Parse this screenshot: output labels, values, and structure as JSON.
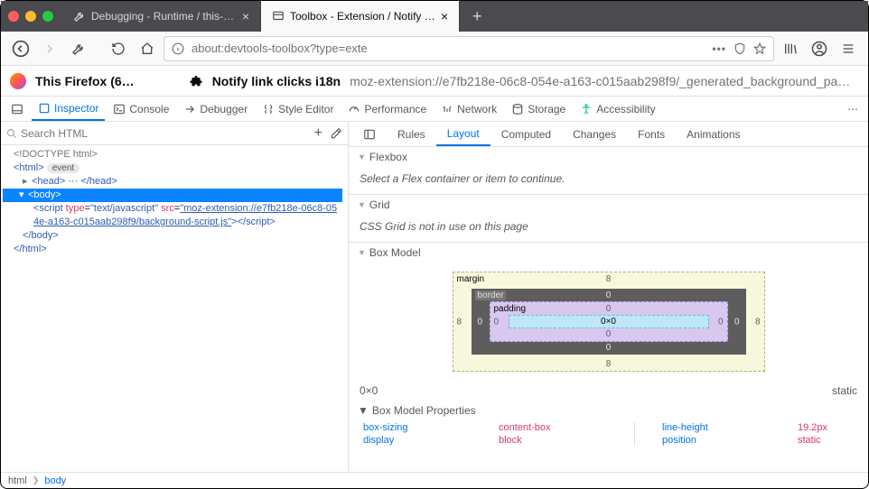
{
  "tabs": {
    "bg": {
      "title": "Debugging - Runtime / this-fire"
    },
    "active": {
      "title": "Toolbox - Extension / Notify link"
    }
  },
  "urlbar": {
    "url": "about:devtools-toolbox?type=exte"
  },
  "target": {
    "firefoxLabel": "This Firefox (6…",
    "extName": "Notify link clicks i18n",
    "extUrl": "moz-extension://e7fb218e-06c8-054e-a163-c015aab298f9/_generated_background_pa…"
  },
  "devtabs": {
    "inspector": "Inspector",
    "console": "Console",
    "debugger": "Debugger",
    "styleEditor": "Style Editor",
    "performance": "Performance",
    "network": "Network",
    "storage": "Storage",
    "accessibility": "Accessibility"
  },
  "search": {
    "placeholder": "Search HTML"
  },
  "tree": {
    "doctype": "<!DOCTYPE html>",
    "htmlOpen": "<html>",
    "event": "event",
    "headOpen": "<head>",
    "headClose": "</head>",
    "bodyOpen": "<body>",
    "bodyClose": "</body>",
    "htmlClose": "</html>",
    "scriptOpen": "<script ",
    "scriptTypeAttr": "type",
    "scriptTypeVal": "\"text/javascript\"",
    "scriptSrcAttr": "src",
    "scriptSrcVal": "\"moz-extension://e7fb218e-06c8-054e-a163-c015aab298f9/background-script.js\"",
    "scriptMid": ">",
    "scriptClose": "</script>"
  },
  "righttabs": {
    "rules": "Rules",
    "layout": "Layout",
    "computed": "Computed",
    "changes": "Changes",
    "fonts": "Fonts",
    "animations": "Animations"
  },
  "flexbox": {
    "title": "Flexbox",
    "body": "Select a Flex container or item to continue."
  },
  "grid": {
    "title": "Grid",
    "body": "CSS Grid is not in use on this page"
  },
  "boxmodel": {
    "title": "Box Model",
    "margin": "margin",
    "border": "border",
    "padding": "padding",
    "content": "0×0",
    "m_t": "8",
    "m_r": "8",
    "m_b": "8",
    "m_l": "8",
    "b_t": "0",
    "b_r": "0",
    "b_b": "0",
    "b_l": "0",
    "p_t": "0",
    "p_r": "0",
    "p_b": "0",
    "p_l": "0",
    "dims": "0×0",
    "pos": "static",
    "propsTitle": "Box Model Properties",
    "props": {
      "p1k": "box-sizing",
      "p1v": "content-box",
      "p2k": "display",
      "p2v": "block",
      "p3k": "line-height",
      "p3v": "19.2px",
      "p4k": "position",
      "p4v": "static"
    }
  },
  "crumbs": {
    "html": "html",
    "body": "body"
  }
}
